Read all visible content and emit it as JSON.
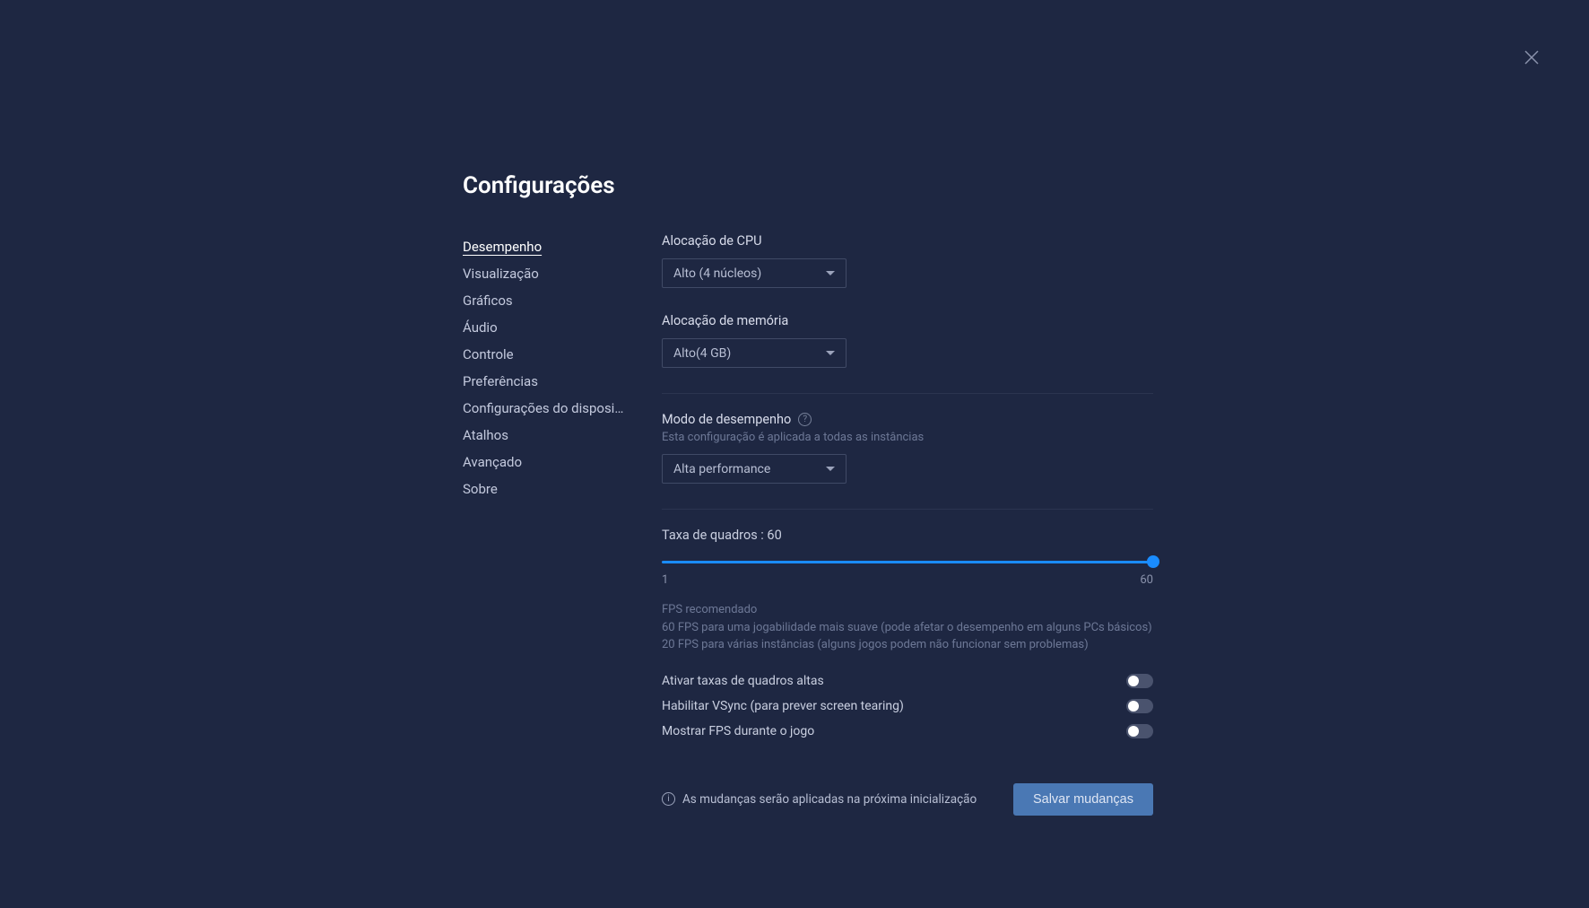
{
  "title": "Configurações",
  "sidebar": {
    "items": [
      {
        "label": "Desempenho",
        "active": true
      },
      {
        "label": "Visualização",
        "active": false
      },
      {
        "label": "Gráficos",
        "active": false
      },
      {
        "label": "Áudio",
        "active": false
      },
      {
        "label": "Controle",
        "active": false
      },
      {
        "label": "Preferências",
        "active": false
      },
      {
        "label": "Configurações do dispositi...",
        "active": false
      },
      {
        "label": "Atalhos",
        "active": false
      },
      {
        "label": "Avançado",
        "active": false
      },
      {
        "label": "Sobre",
        "active": false
      }
    ]
  },
  "sections": {
    "cpu": {
      "label": "Alocação de CPU",
      "value": "Alto (4 núcleos)"
    },
    "memory": {
      "label": "Alocação de memória",
      "value": "Alto(4 GB)"
    },
    "perfmode": {
      "label": "Modo de desempenho",
      "sublabel": "Esta configuração é aplicada a todas as instâncias",
      "value": "Alta performance"
    },
    "fps": {
      "label_prefix": "Taxa de quadros : ",
      "value": "60",
      "min": "1",
      "max": "60",
      "reco_title": "FPS recomendado",
      "reco_body": "60 FPS para uma jogabilidade mais suave (pode afetar o desempenho em alguns PCs básicos) 20 FPS para várias instâncias (alguns jogos podem não funcionar sem problemas)"
    },
    "toggles": {
      "high_fps": "Ativar taxas de quadros altas",
      "vsync": "Habilitar VSync (para prever screen tearing)",
      "show_fps": "Mostrar FPS durante o jogo"
    }
  },
  "footer": {
    "note": "As mudanças serão aplicadas na próxima inicialização",
    "save": "Salvar mudanças"
  }
}
